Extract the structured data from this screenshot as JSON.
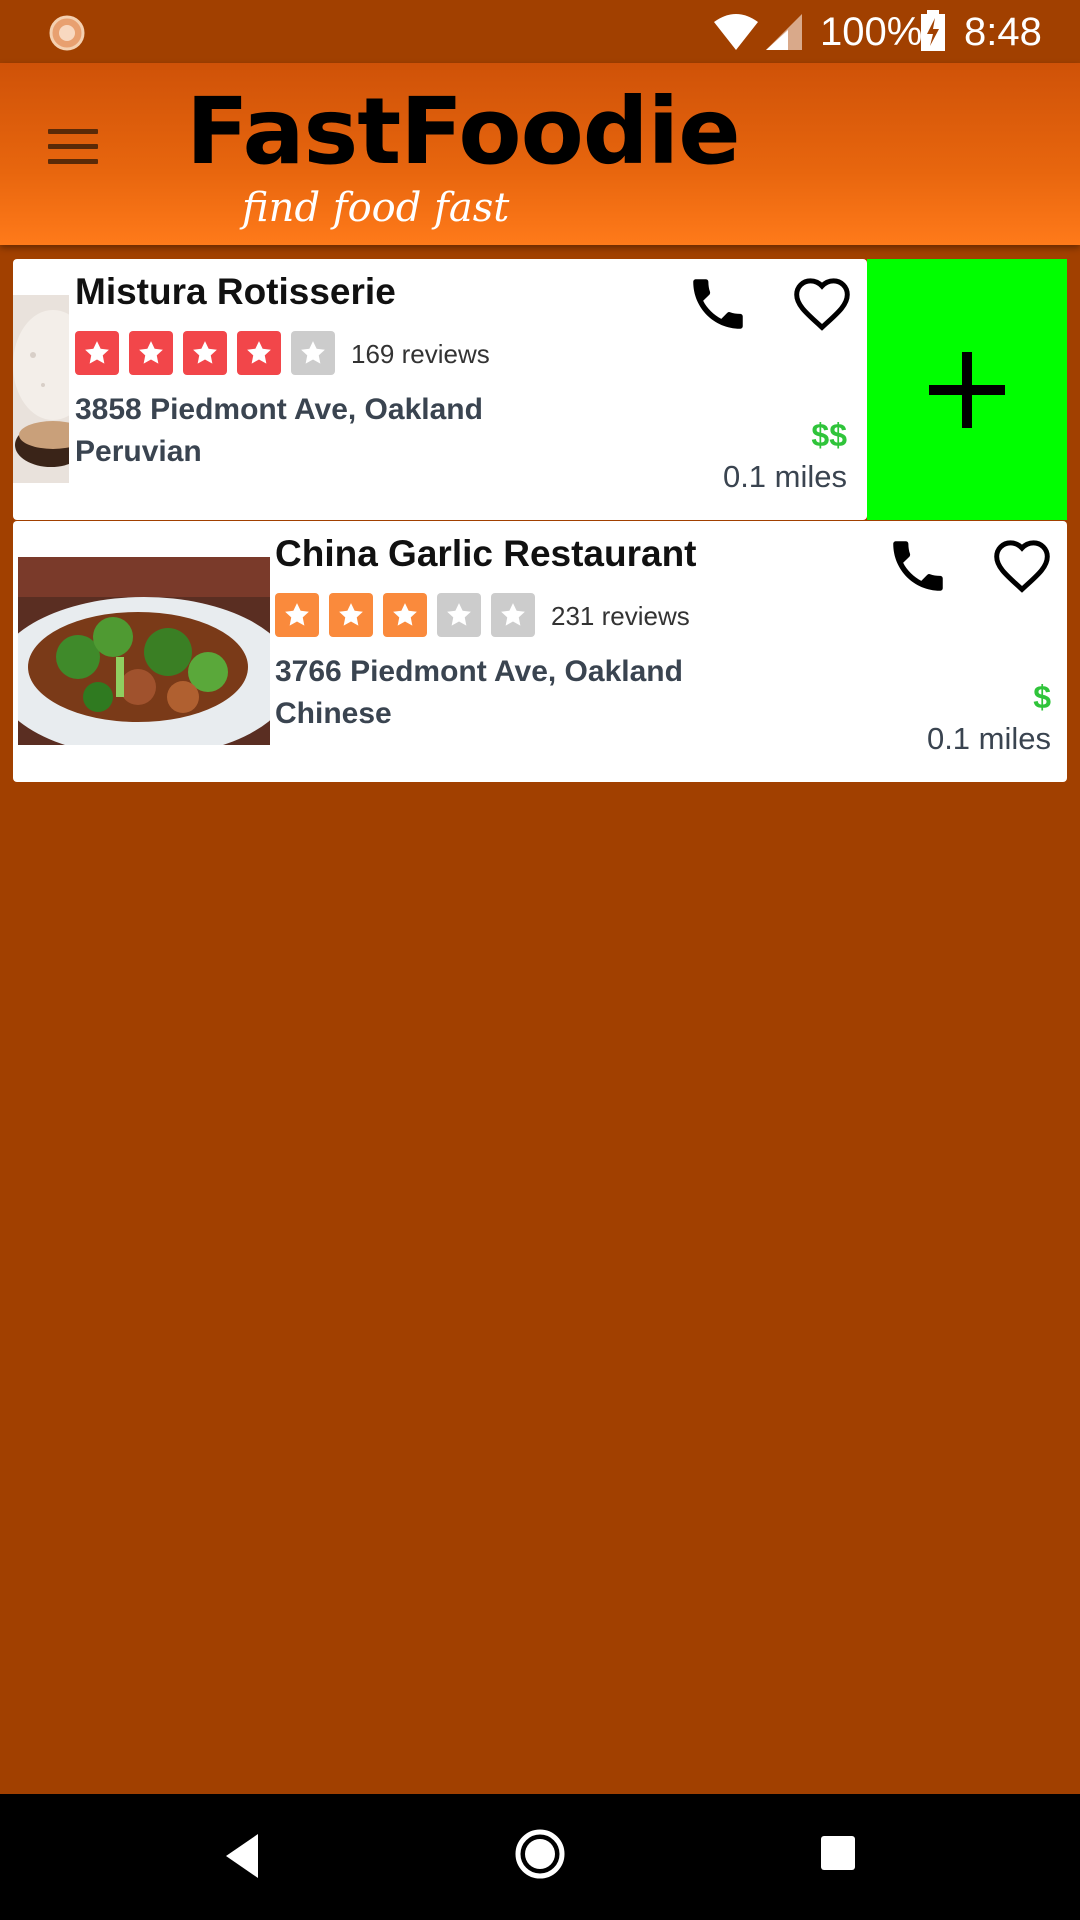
{
  "status_bar": {
    "battery_percent": "100%",
    "time": "8:48"
  },
  "app_bar": {
    "logo_text": "FastFoodie",
    "tagline": "find food fast"
  },
  "colors": {
    "accent_orange": "#a14000",
    "appbar_orange": "#e8660e",
    "add_button_green": "#00ff00",
    "price_green": "#2fc43a",
    "star_red": "#f2464a",
    "star_orange": "#fa8a3c",
    "star_empty": "#cccccc"
  },
  "restaurants": [
    {
      "name": "Mistura Rotisserie",
      "rating": 4,
      "rating_max": 5,
      "star_color": "#f2464a",
      "reviews": "169 reviews",
      "address": "3858 Piedmont Ave, Oakland",
      "cuisine": "Peruvian",
      "price": "$$",
      "distance": "0.1 miles"
    },
    {
      "name": "China Garlic Restaurant",
      "rating": 3,
      "rating_max": 5,
      "star_color": "#fa8a3c",
      "reviews": "231 reviews",
      "address": "3766 Piedmont Ave, Oakland",
      "cuisine": "Chinese",
      "price": "$",
      "distance": "0.1 miles"
    }
  ],
  "icons": {
    "menu": "hamburger-icon",
    "phone": "phone-icon",
    "favorite": "heart-outline-icon",
    "add": "plus-icon",
    "back": "back-triangle-icon",
    "home": "home-circle-icon",
    "recents": "recents-square-icon"
  }
}
